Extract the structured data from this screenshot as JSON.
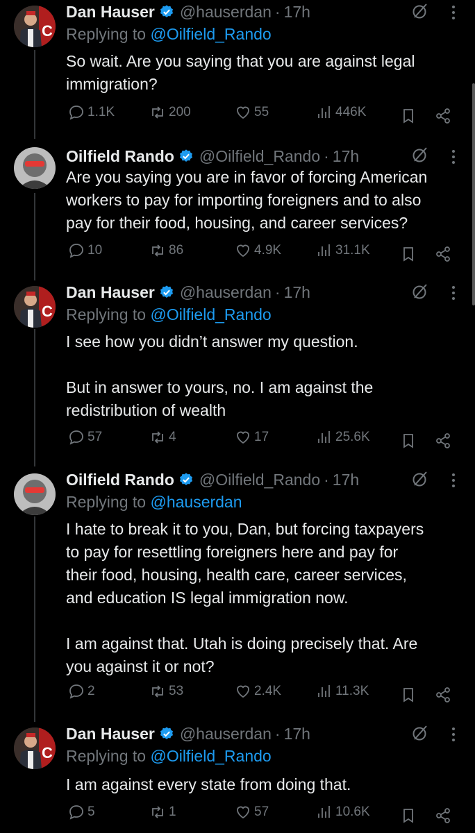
{
  "colors": {
    "background": "#000000",
    "text": "#e7e9ea",
    "muted": "#71767b",
    "link": "#1d9bf0",
    "verified": "#1d9bf0"
  },
  "tweets": [
    {
      "name": "Dan Hauser",
      "handle": "@hauserdan",
      "sep": "·",
      "time": "17h",
      "replying_prefix": "Replying to ",
      "replying_to": "@Oilfield_Rando",
      "text": "So wait. Are you saying that you are against legal\nimmigration?",
      "replies": "1.1K",
      "retweets": "200",
      "likes": "55",
      "views": "446K",
      "avatar": "dan-avatar"
    },
    {
      "name": "Oilfield Rando",
      "handle": "@Oilfield_Rando",
      "sep": "·",
      "time": "17h",
      "replying_prefix": "",
      "replying_to": "",
      "text": "Are you saying you are in favor of forcing American\nworkers to pay for importing foreigners and to also\npay for their food, housing, and career services?",
      "replies": "10",
      "retweets": "86",
      "likes": "4.9K",
      "views": "31.1K",
      "avatar": "rando-avatar"
    },
    {
      "name": "Dan Hauser",
      "handle": "@hauserdan",
      "sep": "·",
      "time": "17h",
      "replying_prefix": "Replying to ",
      "replying_to": "@Oilfield_Rando",
      "text": "I see how you didn’t answer my question.\n\nBut in answer to yours, no. I am against the\nredistribution of wealth",
      "replies": "57",
      "retweets": "4",
      "likes": "17",
      "views": "25.6K",
      "avatar": "dan-avatar"
    },
    {
      "name": "Oilfield Rando",
      "handle": "@Oilfield_Rando",
      "sep": "·",
      "time": "17h",
      "replying_prefix": "Replying to ",
      "replying_to": "@hauserdan",
      "text": "I hate to break it to you, Dan, but forcing taxpayers\nto pay for resettling foreigners here and pay for\ntheir food, housing, health care, career services,\nand education IS legal immigration now.\n\nI am against that. Utah is doing precisely that. Are\nyou against it or not?",
      "replies": "2",
      "retweets": "53",
      "likes": "2.4K",
      "views": "11.3K",
      "avatar": "rando-avatar"
    },
    {
      "name": "Dan Hauser",
      "handle": "@hauserdan",
      "sep": "·",
      "time": "17h",
      "replying_prefix": "Replying to ",
      "replying_to": "@Oilfield_Rando",
      "text": "I am against every state from doing that.",
      "replies": "5",
      "retweets": "1",
      "likes": "57",
      "views": "10.6K",
      "avatar": "dan-avatar"
    }
  ]
}
